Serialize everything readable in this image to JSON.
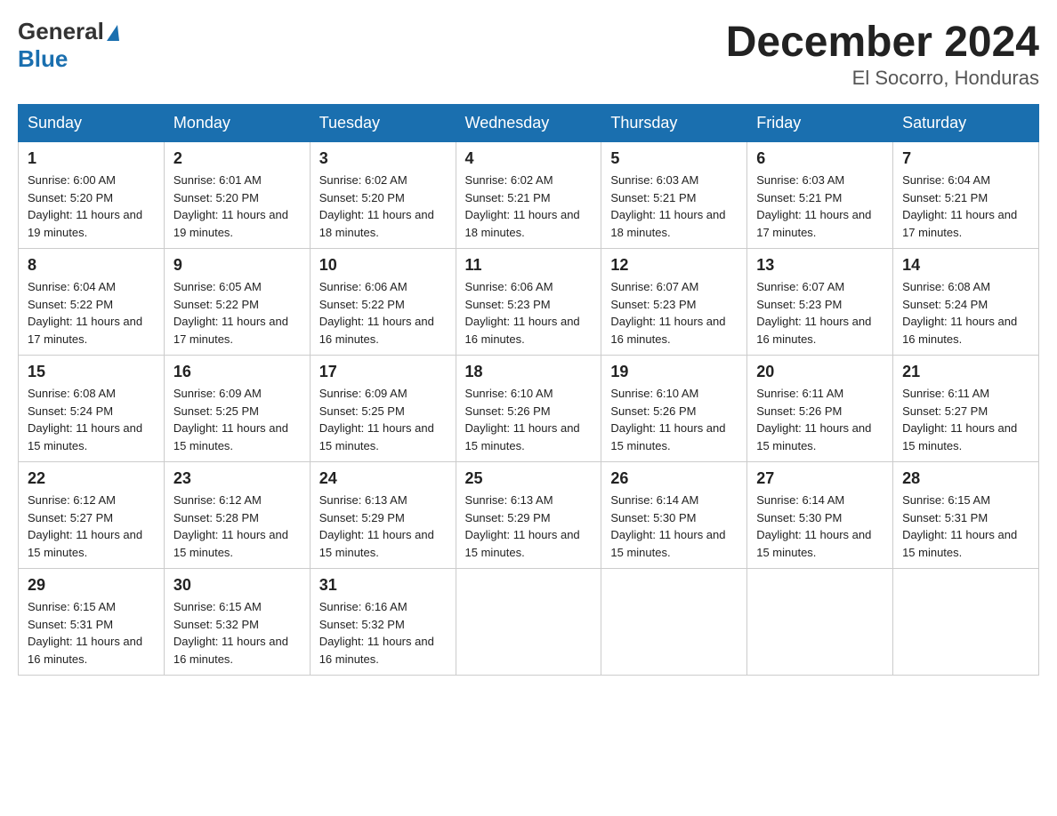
{
  "logo": {
    "line1": "General",
    "triangle": true,
    "line2": "Blue"
  },
  "title": "December 2024",
  "subtitle": "El Socorro, Honduras",
  "days_header": [
    "Sunday",
    "Monday",
    "Tuesday",
    "Wednesday",
    "Thursday",
    "Friday",
    "Saturday"
  ],
  "weeks": [
    [
      {
        "day": 1,
        "sunrise": "6:00 AM",
        "sunset": "5:20 PM",
        "daylight": "11 hours and 19 minutes."
      },
      {
        "day": 2,
        "sunrise": "6:01 AM",
        "sunset": "5:20 PM",
        "daylight": "11 hours and 19 minutes."
      },
      {
        "day": 3,
        "sunrise": "6:02 AM",
        "sunset": "5:20 PM",
        "daylight": "11 hours and 18 minutes."
      },
      {
        "day": 4,
        "sunrise": "6:02 AM",
        "sunset": "5:21 PM",
        "daylight": "11 hours and 18 minutes."
      },
      {
        "day": 5,
        "sunrise": "6:03 AM",
        "sunset": "5:21 PM",
        "daylight": "11 hours and 18 minutes."
      },
      {
        "day": 6,
        "sunrise": "6:03 AM",
        "sunset": "5:21 PM",
        "daylight": "11 hours and 17 minutes."
      },
      {
        "day": 7,
        "sunrise": "6:04 AM",
        "sunset": "5:21 PM",
        "daylight": "11 hours and 17 minutes."
      }
    ],
    [
      {
        "day": 8,
        "sunrise": "6:04 AM",
        "sunset": "5:22 PM",
        "daylight": "11 hours and 17 minutes."
      },
      {
        "day": 9,
        "sunrise": "6:05 AM",
        "sunset": "5:22 PM",
        "daylight": "11 hours and 17 minutes."
      },
      {
        "day": 10,
        "sunrise": "6:06 AM",
        "sunset": "5:22 PM",
        "daylight": "11 hours and 16 minutes."
      },
      {
        "day": 11,
        "sunrise": "6:06 AM",
        "sunset": "5:23 PM",
        "daylight": "11 hours and 16 minutes."
      },
      {
        "day": 12,
        "sunrise": "6:07 AM",
        "sunset": "5:23 PM",
        "daylight": "11 hours and 16 minutes."
      },
      {
        "day": 13,
        "sunrise": "6:07 AM",
        "sunset": "5:23 PM",
        "daylight": "11 hours and 16 minutes."
      },
      {
        "day": 14,
        "sunrise": "6:08 AM",
        "sunset": "5:24 PM",
        "daylight": "11 hours and 16 minutes."
      }
    ],
    [
      {
        "day": 15,
        "sunrise": "6:08 AM",
        "sunset": "5:24 PM",
        "daylight": "11 hours and 15 minutes."
      },
      {
        "day": 16,
        "sunrise": "6:09 AM",
        "sunset": "5:25 PM",
        "daylight": "11 hours and 15 minutes."
      },
      {
        "day": 17,
        "sunrise": "6:09 AM",
        "sunset": "5:25 PM",
        "daylight": "11 hours and 15 minutes."
      },
      {
        "day": 18,
        "sunrise": "6:10 AM",
        "sunset": "5:26 PM",
        "daylight": "11 hours and 15 minutes."
      },
      {
        "day": 19,
        "sunrise": "6:10 AM",
        "sunset": "5:26 PM",
        "daylight": "11 hours and 15 minutes."
      },
      {
        "day": 20,
        "sunrise": "6:11 AM",
        "sunset": "5:26 PM",
        "daylight": "11 hours and 15 minutes."
      },
      {
        "day": 21,
        "sunrise": "6:11 AM",
        "sunset": "5:27 PM",
        "daylight": "11 hours and 15 minutes."
      }
    ],
    [
      {
        "day": 22,
        "sunrise": "6:12 AM",
        "sunset": "5:27 PM",
        "daylight": "11 hours and 15 minutes."
      },
      {
        "day": 23,
        "sunrise": "6:12 AM",
        "sunset": "5:28 PM",
        "daylight": "11 hours and 15 minutes."
      },
      {
        "day": 24,
        "sunrise": "6:13 AM",
        "sunset": "5:29 PM",
        "daylight": "11 hours and 15 minutes."
      },
      {
        "day": 25,
        "sunrise": "6:13 AM",
        "sunset": "5:29 PM",
        "daylight": "11 hours and 15 minutes."
      },
      {
        "day": 26,
        "sunrise": "6:14 AM",
        "sunset": "5:30 PM",
        "daylight": "11 hours and 15 minutes."
      },
      {
        "day": 27,
        "sunrise": "6:14 AM",
        "sunset": "5:30 PM",
        "daylight": "11 hours and 15 minutes."
      },
      {
        "day": 28,
        "sunrise": "6:15 AM",
        "sunset": "5:31 PM",
        "daylight": "11 hours and 15 minutes."
      }
    ],
    [
      {
        "day": 29,
        "sunrise": "6:15 AM",
        "sunset": "5:31 PM",
        "daylight": "11 hours and 16 minutes."
      },
      {
        "day": 30,
        "sunrise": "6:15 AM",
        "sunset": "5:32 PM",
        "daylight": "11 hours and 16 minutes."
      },
      {
        "day": 31,
        "sunrise": "6:16 AM",
        "sunset": "5:32 PM",
        "daylight": "11 hours and 16 minutes."
      },
      null,
      null,
      null,
      null
    ]
  ]
}
